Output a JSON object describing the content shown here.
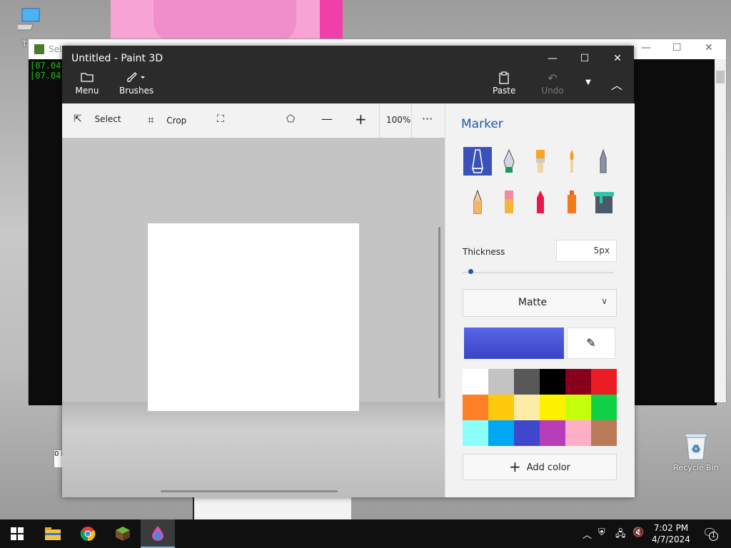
{
  "desktop": {
    "this_pc_label": "This",
    "recycle_bin_label": "Recycle Bin"
  },
  "console": {
    "title": "Sele",
    "lines": [
      "[07.04",
      "[07.04"
    ],
    "behind_text": "0 i"
  },
  "paint": {
    "title": "Untitled - Paint 3D",
    "menu_label": "Menu",
    "brushes_label": "Brushes",
    "paste_label": "Paste",
    "undo_label": "Undo",
    "select_label": "Select",
    "crop_label": "Crop",
    "zoom": "100%",
    "more": "···"
  },
  "side": {
    "title": "Marker",
    "thickness_label": "Thickness",
    "thickness_value": "5px",
    "thickness_fraction": 0.05,
    "finish": "Matte",
    "current_color": "#3a44c4",
    "add_color": "Add color",
    "brushes": [
      "marker-brush",
      "calligraphy-pen-brush",
      "oil-brush",
      "watercolor-brush",
      "pixel-pen-brush",
      "pencil-brush",
      "eraser-brush",
      "crayon-brush",
      "spray-can-brush",
      "fill-bucket-brush"
    ],
    "palette": [
      "#ffffff",
      "#c3c3c3",
      "#585858",
      "#000000",
      "#88001b",
      "#ec1c24",
      "#ff7f27",
      "#ffc90e",
      "#fdeca6",
      "#fff200",
      "#c4ff0e",
      "#0ed145",
      "#8cfffb",
      "#00a8f3",
      "#3f48cc",
      "#b83dba",
      "#ffaec8",
      "#b97a57"
    ]
  },
  "taskbar": {
    "time": "7:02 PM",
    "date": "4/7/2024",
    "notification_count": "1"
  }
}
